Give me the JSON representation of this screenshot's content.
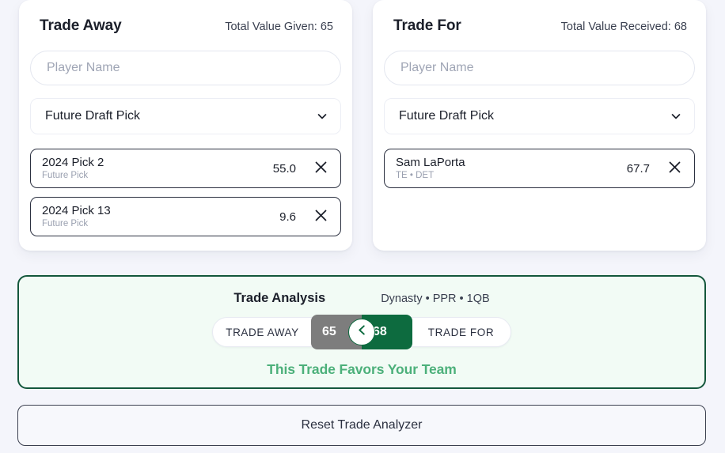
{
  "trade_away": {
    "title": "Trade Away",
    "total_label": "Total Value Given: 65",
    "search_placeholder": "Player Name",
    "search_value": "",
    "select_value": "Future Draft Pick",
    "items": [
      {
        "name": "2024 Pick 2",
        "sub": "Future Pick",
        "value": "55.0",
        "remove_label": "Remove"
      },
      {
        "name": "2024 Pick 13",
        "sub": "Future Pick",
        "value": "9.6",
        "remove_label": "Remove"
      }
    ]
  },
  "trade_for": {
    "title": "Trade For",
    "total_label": "Total Value Received: 68",
    "search_placeholder": "Player Name",
    "search_value": "",
    "select_value": "Future Draft Pick",
    "items": [
      {
        "name": "Sam LaPorta",
        "sub": "TE • DET",
        "value": "67.7",
        "remove_label": "Remove"
      }
    ]
  },
  "analysis": {
    "title": "Trade Analysis",
    "settings": "Dynasty • PPR • 1QB",
    "meter": {
      "left_label": "TRADE AWAY",
      "right_label": "TRADE FOR",
      "left_value": "65",
      "right_value": "68",
      "left_color": "#7d7d7d",
      "right_color": "#0d6b3f",
      "knob_icon": "chevron-left-icon"
    },
    "verdict": "This Trade Favors Your Team",
    "verdict_color": "#4cb07a",
    "border_color": "#14573c"
  },
  "reset": {
    "label": "Reset Trade Analyzer"
  }
}
